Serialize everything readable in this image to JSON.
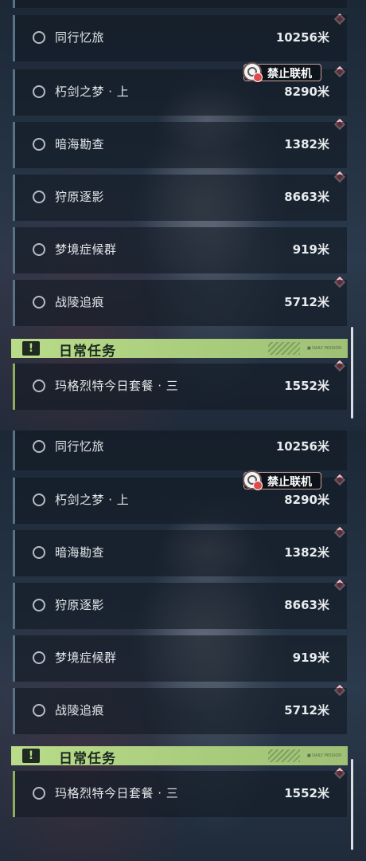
{
  "tasks": [
    {
      "name": "同行忆旅",
      "distance": "10256米"
    },
    {
      "name": "朽剑之梦 · 上",
      "distance": "8290米"
    },
    {
      "name": "暗海勘查",
      "distance": "1382米"
    },
    {
      "name": "狩原逐影",
      "distance": "8663米"
    },
    {
      "name": "梦境症候群",
      "distance": "919米"
    },
    {
      "name": "战陵追痕",
      "distance": "5712米"
    }
  ],
  "badge": {
    "label": "禁止联机",
    "icon": "no-multiplayer-globe-icon"
  },
  "daily_section": {
    "title": "日常任务",
    "icon": "exclamation-icon",
    "tiny_text": "■ DAILY MISSION",
    "task": {
      "name": "玛格烈特今日套餐 · 三",
      "distance": "1552米"
    }
  },
  "colors": {
    "accent_green": "#b9dc8a",
    "marker_red": "#d24a5a",
    "row_border": "#5a7286"
  }
}
